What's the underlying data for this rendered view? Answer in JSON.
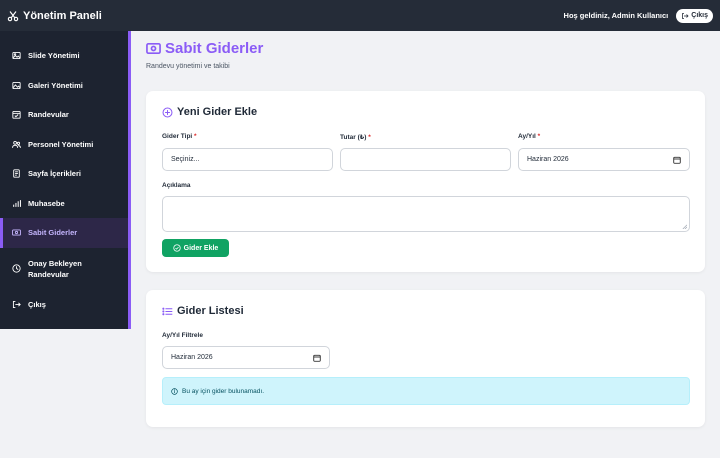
{
  "header": {
    "brand": "Yönetim Paneli",
    "welcome": "Hoş geldiniz, Admin Kullanıcı",
    "logout_label": "Çıkış"
  },
  "sidebar": {
    "items": [
      {
        "label": "Slide Yönetimi",
        "icon": "image-icon"
      },
      {
        "label": "Galeri Yönetimi",
        "icon": "gallery-icon"
      },
      {
        "label": "Randevular",
        "icon": "calendar-check-icon"
      },
      {
        "label": "Personel Yönetimi",
        "icon": "people-icon"
      },
      {
        "label": "Sayfa İçerikleri",
        "icon": "file-text-icon"
      },
      {
        "label": "Muhasebe",
        "icon": "bar-chart-icon"
      },
      {
        "label": "Sabit Giderler",
        "icon": "cash-icon",
        "active": true
      },
      {
        "label": "Onay Bekleyen Randevular",
        "icon": "clock-icon"
      },
      {
        "label": "Çıkış",
        "icon": "logout-icon"
      }
    ]
  },
  "page": {
    "title": "Sabit Giderler",
    "subtitle": "Randevu yönetimi ve takibi"
  },
  "add_form": {
    "title": "Yeni Gider Ekle",
    "type_label": "Gider Tipi",
    "type_value": "Seçiniz...",
    "amount_label": "Tutar (₺)",
    "amount_value": "",
    "month_label": "Ay/Yıl",
    "month_value": "Haziran 2026",
    "desc_label": "Açıklama",
    "desc_value": "",
    "required_mark": "*",
    "submit_label": "Gider Ekle"
  },
  "list": {
    "title": "Gider Listesi",
    "filter_label": "Ay/Yıl Filtrele",
    "filter_value": "Haziran 2026",
    "empty_message": "Bu ay için gider bulunamadı."
  },
  "colors": {
    "accent": "#8b5cf6",
    "sidebar_bg": "#1d2330",
    "topbar_bg": "#252c38",
    "success": "#10a363",
    "info_bg": "#cff4fc"
  }
}
